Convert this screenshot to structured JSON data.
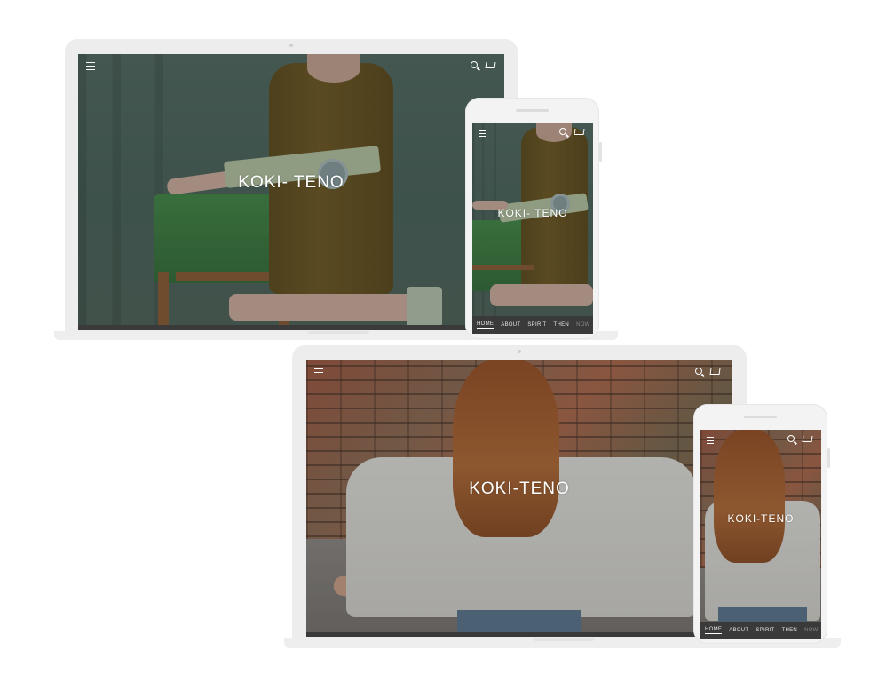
{
  "brand": "KOKI- TENO",
  "brand_alt": "KOKI-TENO",
  "icons": {
    "menu": "menu-icon",
    "search": "search-icon",
    "cart": "cart-icon"
  },
  "nav": {
    "items": [
      "HOME",
      "ABOUT",
      "SPIRIT",
      "THEN",
      "NOW"
    ],
    "active": "HOME"
  },
  "colors": {
    "navbar": "#3a3a3a",
    "device_frame": "#ededee",
    "background": "#ffffff"
  }
}
